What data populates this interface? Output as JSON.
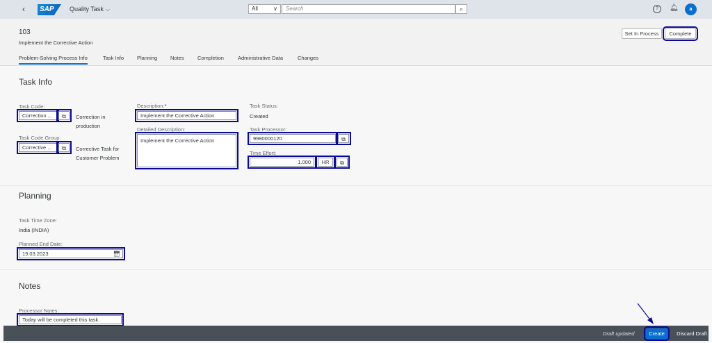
{
  "shell": {
    "app_title": "Quality Task",
    "search_scope": "All",
    "search_placeholder": "Search",
    "avatar_initial": "a"
  },
  "header": {
    "object_id": "103",
    "object_subtitle": "Implement the Corrective Action",
    "set_in_process_label": "Set In Process",
    "complete_label": "Complete",
    "tabs": [
      {
        "label": "Problem-Solving Process Info",
        "active": true
      },
      {
        "label": "Task Info"
      },
      {
        "label": "Planning"
      },
      {
        "label": "Notes"
      },
      {
        "label": "Completion"
      },
      {
        "label": "Administrative Data"
      },
      {
        "label": "Changes"
      }
    ]
  },
  "task_info": {
    "title": "Task Info",
    "task_code_label": "Task Code:",
    "task_code_value": "Correction ...",
    "task_code_text": "Correction in production",
    "task_code_group_label": "Task Code Group:",
    "task_code_group_value": "Corrective ...",
    "task_code_group_text": "Corrective Task for Customer Problem",
    "description_label": "Description:",
    "description_required": "*",
    "description_value": "Implement the Corrective Action",
    "detailed_description_label": "Detailed Description:",
    "detailed_description_value": "Implement the Corrective Action",
    "task_status_label": "Task Status:",
    "task_status_value": "Created",
    "task_processor_label": "Task Processor:",
    "task_processor_value": "9980000120",
    "time_effort_label": "Time Effort:",
    "time_effort_value": "1.000",
    "time_effort_unit": "HR"
  },
  "planning": {
    "title": "Planning",
    "time_zone_label": "Task Time Zone:",
    "time_zone_value": "India (INDIA)",
    "planned_end_label": "Planned End Date:",
    "planned_end_value": "19.03.2023"
  },
  "notes": {
    "title": "Notes",
    "processor_notes_label": "Processor Notes:",
    "processor_notes_value": "Today will be completed this task."
  },
  "footer": {
    "draft_message": "Draft updated",
    "create_label": "Create",
    "discard_label": "Discard Draft"
  },
  "colors": {
    "accent": "#0a6ed1",
    "highlight": "#0a0a96",
    "footer_bg": "#495057"
  }
}
